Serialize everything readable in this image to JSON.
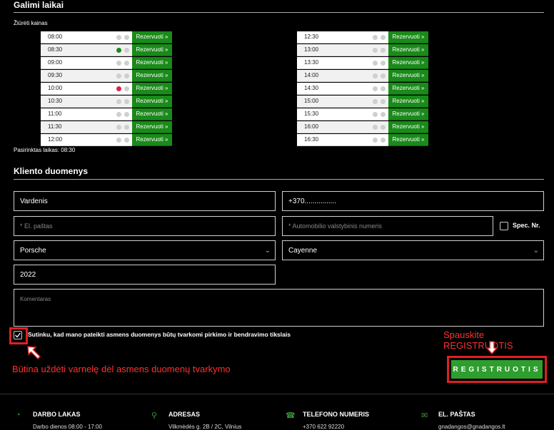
{
  "sections": {
    "times_title": "Galimi laikai",
    "view_prices": "Žiūrėti kainas",
    "selected_time": "Pasirinktas laikas: 08:30",
    "client_title": "Kliento duomenys"
  },
  "reserve_label": "Rezervuoti »",
  "slots_left": [
    {
      "time": "08:00",
      "state": "none"
    },
    {
      "time": "08:30",
      "state": "green"
    },
    {
      "time": "09:00",
      "state": "none"
    },
    {
      "time": "09:30",
      "state": "none"
    },
    {
      "time": "10:00",
      "state": "red"
    },
    {
      "time": "10:30",
      "state": "none"
    },
    {
      "time": "11:00",
      "state": "none"
    },
    {
      "time": "11:30",
      "state": "none"
    },
    {
      "time": "12:00",
      "state": "none"
    }
  ],
  "slots_right": [
    {
      "time": "12:30",
      "state": "none"
    },
    {
      "time": "13:00",
      "state": "none"
    },
    {
      "time": "13:30",
      "state": "none"
    },
    {
      "time": "14:00",
      "state": "none"
    },
    {
      "time": "14:30",
      "state": "none"
    },
    {
      "time": "15:00",
      "state": "none"
    },
    {
      "time": "15:30",
      "state": "none"
    },
    {
      "time": "16:00",
      "state": "none"
    },
    {
      "time": "16:30",
      "state": "none"
    }
  ],
  "colors": {
    "green": "#1a8a1a",
    "red": "#e0204a",
    "grey": "#cfcfcf"
  },
  "form": {
    "name_value": "Vardenis",
    "phone_value": "+370................",
    "email_placeholder": "* El. paštas",
    "plate_placeholder": "* Automobilio valstybinis numeris",
    "spec_label": "Spec. Nr.",
    "make_value": "Porsche",
    "model_value": "Cayenne",
    "year_value": "2022",
    "comment_placeholder": "Komentaras",
    "consent_label": "Sutinku, kad mano pateikti asmens duomenys būtų tvarkomi pirkimo ir bendravimo tikslais",
    "register_label": "REGISTRUOTIS"
  },
  "annotations": {
    "click_register": "Spauskite REGISTRUOTIS",
    "must_check": "Būtina uždėti varnelę dėl asmens duomenų tvarkymo"
  },
  "footer": [
    {
      "icon": "clock-icon",
      "glyph": "◔",
      "title": "DARBO LAKAS",
      "sub": "Darbo dienos    08:00 - 17:00"
    },
    {
      "icon": "map-pin-icon",
      "glyph": "⚲",
      "title": "ADRESAS",
      "sub": "Vilkmėdės g. 2B / 2C, Vilnius"
    },
    {
      "icon": "phone-icon",
      "glyph": "☎",
      "title": "TELEFONO NUMERIS",
      "sub": "+370 622 92220"
    },
    {
      "icon": "mail-icon",
      "glyph": "✉",
      "title": "EL. PAŠTAS",
      "sub": "gnadangos@gnadangos.lt"
    }
  ]
}
